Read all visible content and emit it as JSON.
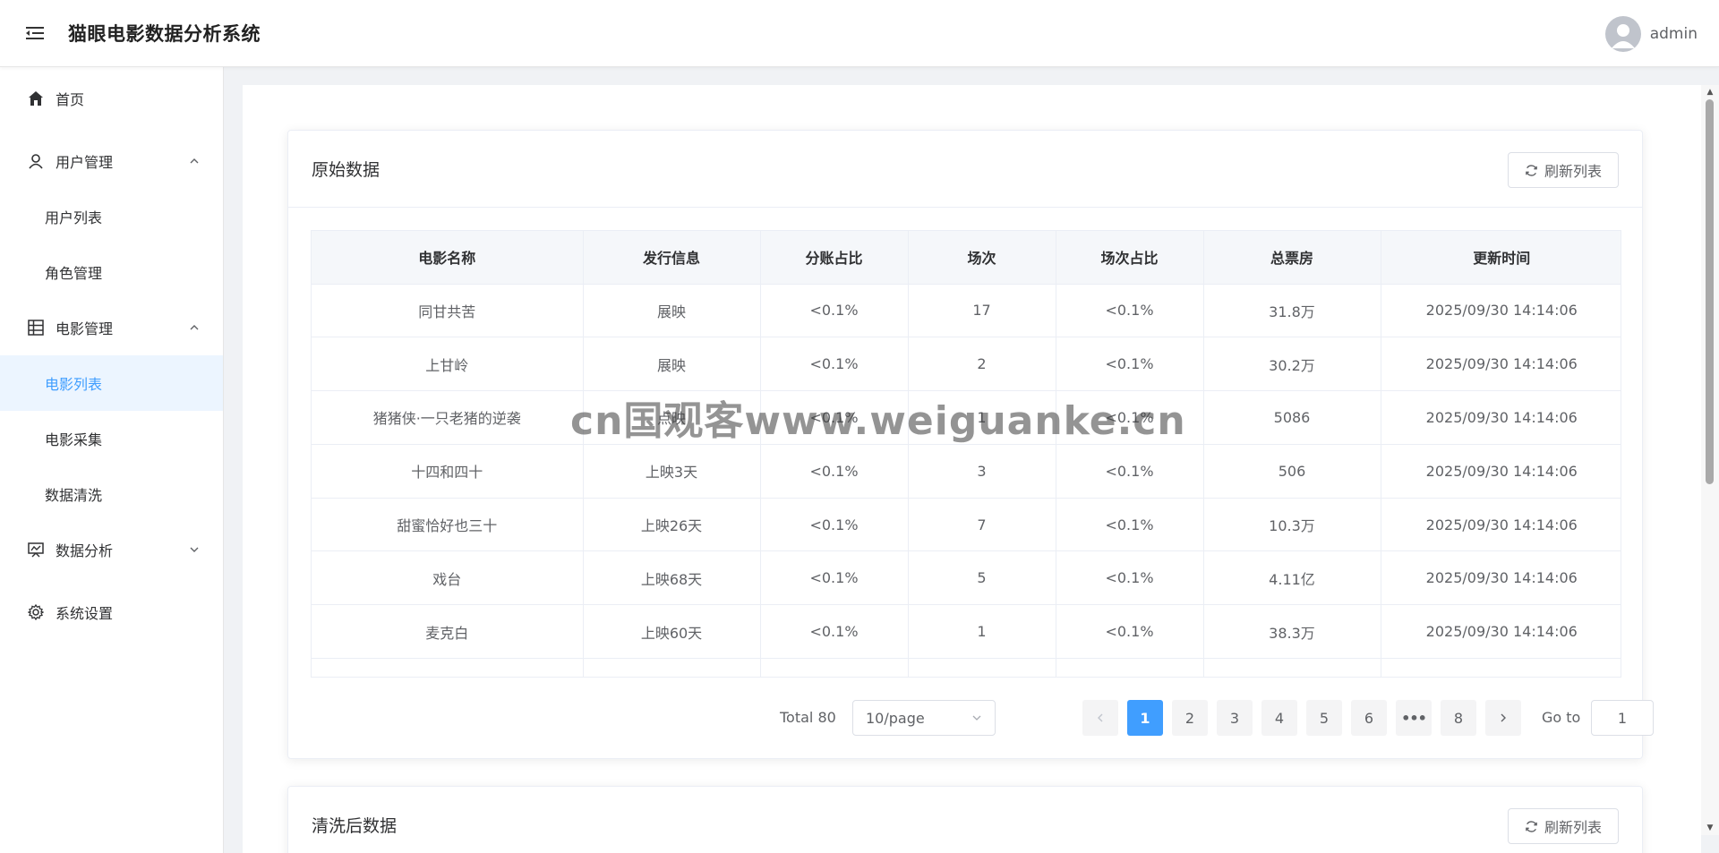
{
  "header": {
    "app_title": "猫眼电影数据分析系统",
    "username": "admin"
  },
  "sidebar": {
    "items": [
      {
        "label": "首页"
      },
      {
        "label": "用户管理",
        "children": [
          {
            "label": "用户列表"
          },
          {
            "label": "角色管理"
          }
        ]
      },
      {
        "label": "电影管理",
        "children": [
          {
            "label": "电影列表"
          },
          {
            "label": "电影采集"
          },
          {
            "label": "数据清洗"
          }
        ]
      },
      {
        "label": "数据分析"
      },
      {
        "label": "系统设置"
      }
    ],
    "active": "电影列表"
  },
  "card1": {
    "title": "原始数据",
    "refresh_label": "刷新列表",
    "columns": [
      "电影名称",
      "发行信息",
      "分账占比",
      "场次",
      "场次占比",
      "总票房",
      "更新时间"
    ],
    "rows": [
      [
        "同甘共苦",
        "展映",
        "<0.1%",
        "17",
        "<0.1%",
        "31.8万",
        "2025/09/30 14:14:06"
      ],
      [
        "上甘岭",
        "展映",
        "<0.1%",
        "2",
        "<0.1%",
        "30.2万",
        "2025/09/30 14:14:06"
      ],
      [
        "猪猪侠·一只老猪的逆袭",
        "点映",
        "<0.1%",
        "1",
        "<0.1%",
        "5086",
        "2025/09/30 14:14:06"
      ],
      [
        "十四和四十",
        "上映3天",
        "<0.1%",
        "3",
        "<0.1%",
        "506",
        "2025/09/30 14:14:06"
      ],
      [
        "甜蜜恰好也三十",
        "上映26天",
        "<0.1%",
        "7",
        "<0.1%",
        "10.3万",
        "2025/09/30 14:14:06"
      ],
      [
        "戏台",
        "上映68天",
        "<0.1%",
        "5",
        "<0.1%",
        "4.11亿",
        "2025/09/30 14:14:06"
      ],
      [
        "麦克白",
        "上映60天",
        "<0.1%",
        "1",
        "<0.1%",
        "38.3万",
        "2025/09/30 14:14:06"
      ],
      [
        "",
        "",
        "",
        "",
        "",
        "",
        ""
      ]
    ]
  },
  "pagination": {
    "total_label": "Total 80",
    "page_size": "10/page",
    "pages": [
      "1",
      "2",
      "3",
      "4",
      "5",
      "6",
      "•••",
      "8"
    ],
    "current": "1",
    "goto_label": "Go to",
    "goto_value": "1"
  },
  "card2": {
    "title": "清洗后数据",
    "refresh_label": "刷新列表"
  },
  "watermark": "cn国观客www.weiguanke.cn",
  "colors": {
    "primary": "#409eff",
    "active_bg": "#ecf5ff",
    "border": "#ebeef5"
  }
}
